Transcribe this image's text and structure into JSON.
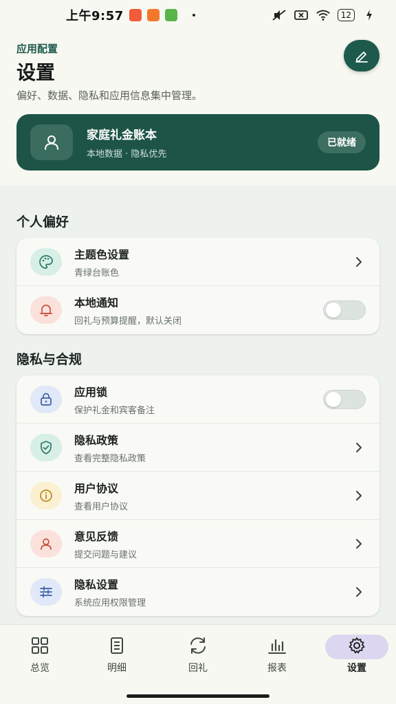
{
  "status_bar": {
    "time": "上午9:57",
    "battery": "12"
  },
  "header": {
    "eyebrow": "应用配置",
    "title": "设置",
    "subtitle": "偏好、数据、隐私和应用信息集中管理。"
  },
  "account": {
    "name": "家庭礼金账本",
    "meta": "本地数据 · 隐私优先",
    "badge": "已就绪"
  },
  "sections": {
    "personal": {
      "title": "个人偏好",
      "items": [
        {
          "title": "主题色设置",
          "subtitle": "青绿台账色",
          "icon": "palette-icon",
          "control": "chevron"
        },
        {
          "title": "本地通知",
          "subtitle": "回礼与预算提醒，默认关闭",
          "icon": "bell-icon",
          "control": "toggle-off"
        }
      ]
    },
    "privacy": {
      "title": "隐私与合规",
      "items": [
        {
          "title": "应用锁",
          "subtitle": "保护礼金和宾客备注",
          "icon": "lock-icon",
          "control": "toggle-off"
        },
        {
          "title": "隐私政策",
          "subtitle": "查看完整隐私政策",
          "icon": "shield-icon",
          "control": "chevron"
        },
        {
          "title": "用户协议",
          "subtitle": "查看用户协议",
          "icon": "info-icon",
          "control": "chevron"
        },
        {
          "title": "意见反馈",
          "subtitle": "提交问题与建议",
          "icon": "person-icon",
          "control": "chevron"
        },
        {
          "title": "隐私设置",
          "subtitle": "系统应用权限管理",
          "icon": "sliders-icon",
          "control": "chevron"
        }
      ]
    }
  },
  "nav": {
    "items": [
      {
        "label": "总览",
        "icon": "grid-icon"
      },
      {
        "label": "明细",
        "icon": "list-icon"
      },
      {
        "label": "回礼",
        "icon": "refresh-icon"
      },
      {
        "label": "报表",
        "icon": "bar-chart-icon"
      },
      {
        "label": "设置",
        "icon": "gear-icon",
        "active": true
      }
    ]
  },
  "colors": {
    "primary": "#1d5447",
    "background": "#eef2ef",
    "active_pill": "#ddd6f0"
  }
}
